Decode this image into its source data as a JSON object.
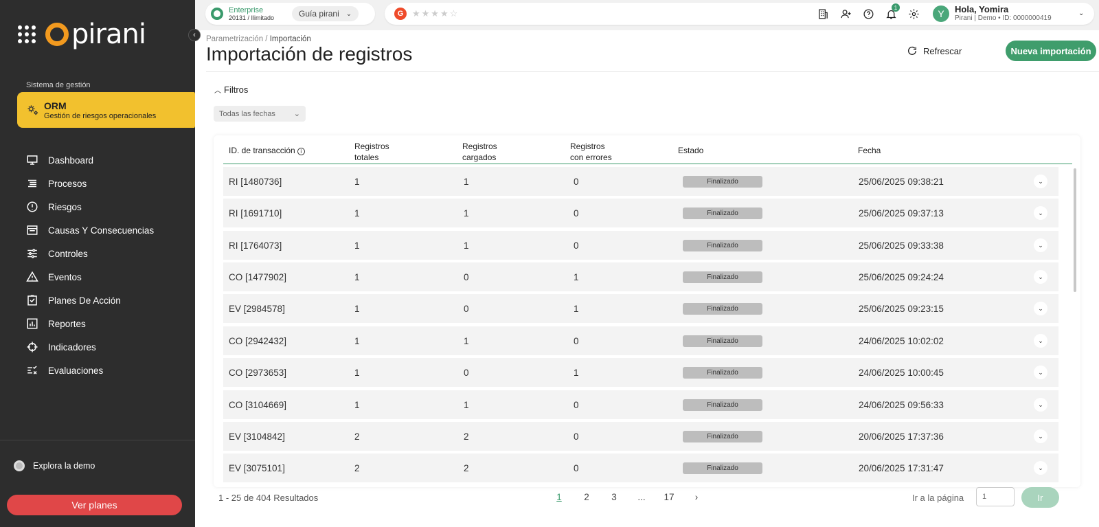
{
  "brand": {
    "name": "pirani"
  },
  "sidebar": {
    "caption": "Sistema de gestión",
    "module": {
      "title": "ORM",
      "subtitle": "Gestión de riesgos operacionales"
    },
    "items": [
      {
        "label": "Dashboard",
        "icon": "monitor-icon"
      },
      {
        "label": "Procesos",
        "icon": "list-icon"
      },
      {
        "label": "Riesgos",
        "icon": "alert-circle-icon"
      },
      {
        "label": "Causas Y Consecuencias",
        "icon": "window-icon"
      },
      {
        "label": "Controles",
        "icon": "sliders-icon"
      },
      {
        "label": "Eventos",
        "icon": "warning-triangle-icon"
      },
      {
        "label": "Planes De Acción",
        "icon": "checklist-icon"
      },
      {
        "label": "Reportes",
        "icon": "bar-chart-icon"
      },
      {
        "label": "Indicadores",
        "icon": "crosshair-icon"
      },
      {
        "label": "Evaluaciones",
        "icon": "evaluation-icon"
      }
    ],
    "demo_label": "Explora la demo",
    "plans_button": "Ver planes"
  },
  "topbar": {
    "plan_name": "Enterprise",
    "plan_sub": "20131 / Ilimitado",
    "guide_label": "Guía pirani",
    "rating_badge": "G",
    "stars": "★★★★☆",
    "notification_count": "1",
    "avatar_letter": "Y",
    "user_greeting": "Hola, Yomira",
    "user_sub": "Pirani | Demo • ID: 0000000419"
  },
  "page": {
    "breadcrumb_parent": "Parametrización /",
    "breadcrumb_current": "Importación",
    "title": "Importación de registros",
    "refresh_label": "Refrescar",
    "new_import_label": "Nueva importación",
    "filters_label": "Filtros",
    "date_filter": "Todas las fechas"
  },
  "table": {
    "headers": {
      "id": "ID. de transacción",
      "total_1": "Registros",
      "total_2": "totales",
      "loaded_1": "Registros",
      "loaded_2": "cargados",
      "errors_1": "Registros",
      "errors_2": "con errores",
      "status": "Estado",
      "date": "Fecha"
    },
    "rows": [
      {
        "id": "RI [1480736]",
        "total": "1",
        "loaded": "1",
        "errors": "0",
        "status": "Finalizado",
        "date": "25/06/2025 09:38:21"
      },
      {
        "id": "RI [1691710]",
        "total": "1",
        "loaded": "1",
        "errors": "0",
        "status": "Finalizado",
        "date": "25/06/2025 09:37:13"
      },
      {
        "id": "RI [1764073]",
        "total": "1",
        "loaded": "1",
        "errors": "0",
        "status": "Finalizado",
        "date": "25/06/2025 09:33:38"
      },
      {
        "id": "CO [1477902]",
        "total": "1",
        "loaded": "0",
        "errors": "1",
        "status": "Finalizado",
        "date": "25/06/2025 09:24:24"
      },
      {
        "id": "EV [2984578]",
        "total": "1",
        "loaded": "0",
        "errors": "1",
        "status": "Finalizado",
        "date": "25/06/2025 09:23:15"
      },
      {
        "id": "CO [2942432]",
        "total": "1",
        "loaded": "1",
        "errors": "0",
        "status": "Finalizado",
        "date": "24/06/2025 10:02:02"
      },
      {
        "id": "CO [2973653]",
        "total": "1",
        "loaded": "0",
        "errors": "1",
        "status": "Finalizado",
        "date": "24/06/2025 10:00:45"
      },
      {
        "id": "CO [3104669]",
        "total": "1",
        "loaded": "1",
        "errors": "0",
        "status": "Finalizado",
        "date": "24/06/2025 09:56:33"
      },
      {
        "id": "EV [3104842]",
        "total": "2",
        "loaded": "2",
        "errors": "0",
        "status": "Finalizado",
        "date": "20/06/2025 17:37:36"
      },
      {
        "id": "EV [3075101]",
        "total": "2",
        "loaded": "2",
        "errors": "0",
        "status": "Finalizado",
        "date": "20/06/2025 17:31:47"
      }
    ]
  },
  "pagination": {
    "summary": "1 - 25 de 404 Resultados",
    "pages": [
      "1",
      "2",
      "3",
      "...",
      "17"
    ],
    "current": "1",
    "goto_label": "Ir a la página",
    "goto_placeholder": "1",
    "goto_button": "Ir"
  },
  "colors": {
    "accent": "#3a9a6c",
    "module": "#f2c12e",
    "danger": "#e04748",
    "sidebar": "#2d2d2d"
  }
}
